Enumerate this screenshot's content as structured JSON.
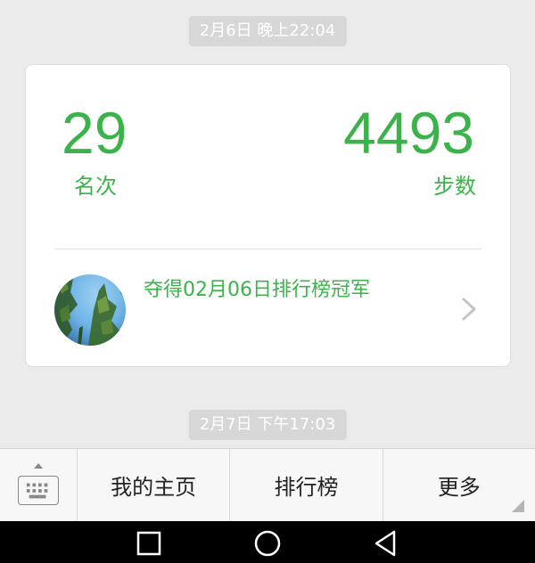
{
  "messages": {
    "timestamp_1": "2月6日 晚上22:04",
    "timestamp_2": "2月7日 下午17:03"
  },
  "rank_card": {
    "rank_value": "29",
    "rank_label": "名次",
    "steps_value": "4493",
    "steps_label": "步数",
    "champion_text": "夺得02月06日排行榜冠军",
    "accent_color": "#3cb34a"
  },
  "bottom_menu": {
    "keyboard_icon": "keyboard-icon",
    "items": [
      {
        "label": "我的主页"
      },
      {
        "label": "排行榜"
      },
      {
        "label": "更多"
      }
    ]
  },
  "nav_bar": {
    "icons": [
      "recent-apps-icon",
      "home-icon",
      "back-icon"
    ]
  }
}
